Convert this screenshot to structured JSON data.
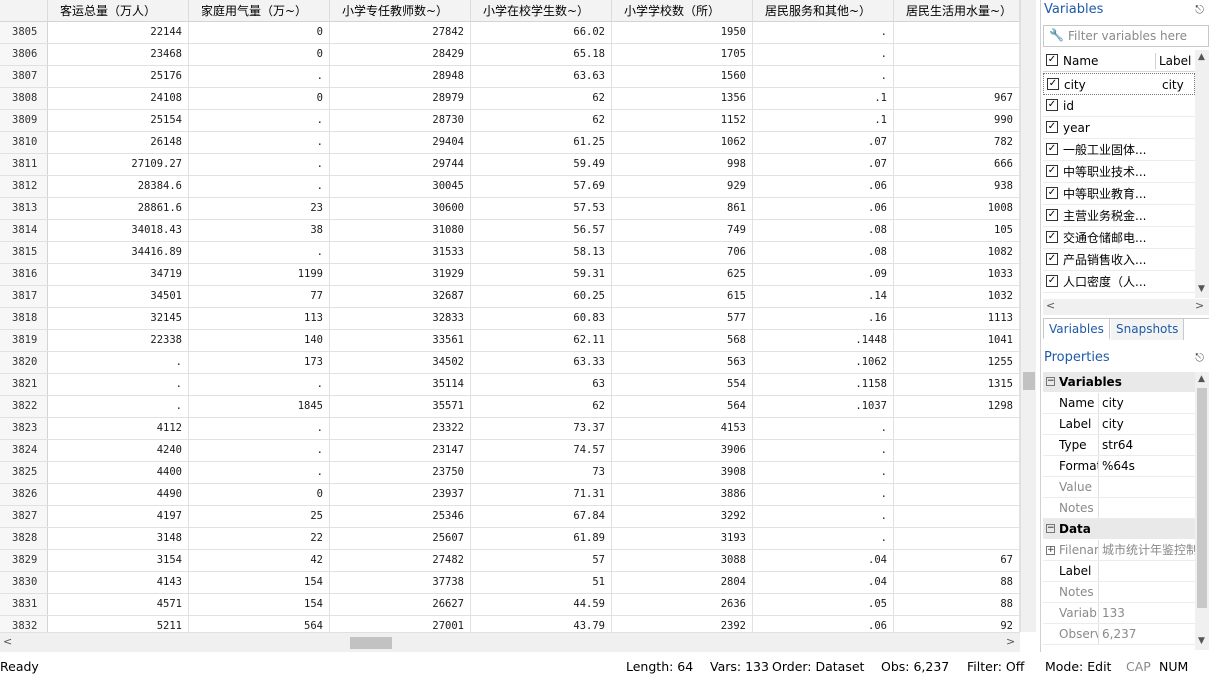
{
  "grid": {
    "columns": [
      {
        "label": "",
        "width": 48
      },
      {
        "label": "客运总量（万人）",
        "width": 141
      },
      {
        "label": "家庭用气量（万~）",
        "width": 141
      },
      {
        "label": "小学专任教师数~）",
        "width": 141
      },
      {
        "label": "小学在校学生数~）",
        "width": 141
      },
      {
        "label": "小学学校数（所）",
        "width": 141
      },
      {
        "label": "居民服务和其他~）",
        "width": 141
      },
      {
        "label": "居民生活用水量~）",
        "width": 126
      }
    ],
    "rows": [
      [
        "3805",
        "22144",
        "0",
        "27842",
        "66.02",
        "1950",
        ".",
        ""
      ],
      [
        "3806",
        "23468",
        "0",
        "28429",
        "65.18",
        "1705",
        ".",
        ""
      ],
      [
        "3807",
        "25176",
        ".",
        "28948",
        "63.63",
        "1560",
        ".",
        ""
      ],
      [
        "3808",
        "24108",
        "0",
        "28979",
        "62",
        "1356",
        ".1",
        "967"
      ],
      [
        "3809",
        "25154",
        ".",
        "28730",
        "62",
        "1152",
        ".1",
        "990"
      ],
      [
        "3810",
        "26148",
        ".",
        "29404",
        "61.25",
        "1062",
        ".07",
        "782"
      ],
      [
        "3811",
        "27109.27",
        ".",
        "29744",
        "59.49",
        "998",
        ".07",
        "666"
      ],
      [
        "3812",
        "28384.6",
        ".",
        "30045",
        "57.69",
        "929",
        ".06",
        "938"
      ],
      [
        "3813",
        "28861.6",
        "23",
        "30600",
        "57.53",
        "861",
        ".06",
        "1008"
      ],
      [
        "3814",
        "34018.43",
        "38",
        "31080",
        "56.57",
        "749",
        ".08",
        "105"
      ],
      [
        "3815",
        "34416.89",
        ".",
        "31533",
        "58.13",
        "706",
        ".08",
        "1082"
      ],
      [
        "3816",
        "34719",
        "1199",
        "31929",
        "59.31",
        "625",
        ".09",
        "1033"
      ],
      [
        "3817",
        "34501",
        "77",
        "32687",
        "60.25",
        "615",
        ".14",
        "1032"
      ],
      [
        "3818",
        "32145",
        "113",
        "32833",
        "60.83",
        "577",
        ".16",
        "1113"
      ],
      [
        "3819",
        "22338",
        "140",
        "33561",
        "62.11",
        "568",
        ".1448",
        "1041"
      ],
      [
        "3820",
        ".",
        "173",
        "34502",
        "63.33",
        "563",
        ".1062",
        "1255"
      ],
      [
        "3821",
        ".",
        ".",
        "35114",
        "63",
        "554",
        ".1158",
        "1315"
      ],
      [
        "3822",
        ".",
        "1845",
        "35571",
        "62",
        "564",
        ".1037",
        "1298"
      ],
      [
        "3823",
        "4112",
        ".",
        "23322",
        "73.37",
        "4153",
        ".",
        ""
      ],
      [
        "3824",
        "4240",
        ".",
        "23147",
        "74.57",
        "3906",
        ".",
        ""
      ],
      [
        "3825",
        "4400",
        ".",
        "23750",
        "73",
        "3908",
        ".",
        ""
      ],
      [
        "3826",
        "4490",
        "0",
        "23937",
        "71.31",
        "3886",
        ".",
        ""
      ],
      [
        "3827",
        "4197",
        "25",
        "25346",
        "67.84",
        "3292",
        ".",
        ""
      ],
      [
        "3828",
        "3148",
        "22",
        "25607",
        "61.89",
        "3193",
        ".",
        ""
      ],
      [
        "3829",
        "3154",
        "42",
        "27482",
        "57",
        "3088",
        ".04",
        "67"
      ],
      [
        "3830",
        "4143",
        "154",
        "37738",
        "51",
        "2804",
        ".04",
        "88"
      ],
      [
        "3831",
        "4571",
        "154",
        "26627",
        "44.59",
        "2636",
        ".05",
        "88"
      ],
      [
        "3832",
        "5211",
        "564",
        "27001",
        "43.79",
        "2392",
        ".06",
        "92"
      ]
    ]
  },
  "variables_panel": {
    "title": "Variables",
    "pin_icon": "pin-icon",
    "filter_placeholder": "Filter variables here",
    "header_name": "Name",
    "header_label": "Label",
    "items": [
      {
        "name": "city",
        "label": "city",
        "checked": true,
        "selected": true
      },
      {
        "name": "id",
        "label": "",
        "checked": true
      },
      {
        "name": "year",
        "label": "",
        "checked": true
      },
      {
        "name": "一般工业固体...",
        "label": "",
        "checked": true
      },
      {
        "name": "中等职业技术...",
        "label": "",
        "checked": true
      },
      {
        "name": "中等职业教育...",
        "label": "",
        "checked": true
      },
      {
        "name": "主营业务税金...",
        "label": "",
        "checked": true
      },
      {
        "name": "交通仓储邮电...",
        "label": "",
        "checked": true
      },
      {
        "name": "产品销售收入...",
        "label": "",
        "checked": true
      },
      {
        "name": "人口密度（人...",
        "label": "",
        "checked": true
      }
    ]
  },
  "tabs": [
    "Variables",
    "Snapshots"
  ],
  "properties_panel": {
    "title": "Properties",
    "sections": [
      {
        "title": "Variables",
        "rows": [
          {
            "key": "Name",
            "value": "city",
            "dim": false
          },
          {
            "key": "Label",
            "value": "city",
            "dim": false
          },
          {
            "key": "Type",
            "value": "str64",
            "dim": false
          },
          {
            "key": "Format",
            "value": "%64s",
            "dim": false
          },
          {
            "key": "Value",
            "value": "",
            "dim": true
          },
          {
            "key": "Notes",
            "value": "",
            "dim": true
          }
        ]
      },
      {
        "title": "Data",
        "rows": [
          {
            "key": "Filename",
            "value": "城市统计年鉴控制",
            "dim": true,
            "expand": true
          },
          {
            "key": "Label",
            "value": "",
            "dim": false
          },
          {
            "key": "Notes",
            "value": "",
            "dim": true
          },
          {
            "key": "Variables",
            "value": "133",
            "dim": true
          },
          {
            "key": "Observations",
            "value": "6,237",
            "dim": true
          }
        ]
      }
    ]
  },
  "status_bar": {
    "ready": "Ready",
    "length": "Length: 64",
    "vars": "Vars: 133",
    "order": "Order: Dataset",
    "obs": "Obs: 6,237",
    "filter": "Filter: Off",
    "mode": "Mode: Edit",
    "cap": "CAP",
    "num": "NUM"
  },
  "colors": {
    "accent": "#1e5aa8",
    "header_bg": "#f3f3f3",
    "grid_line": "#e1e1e1"
  }
}
